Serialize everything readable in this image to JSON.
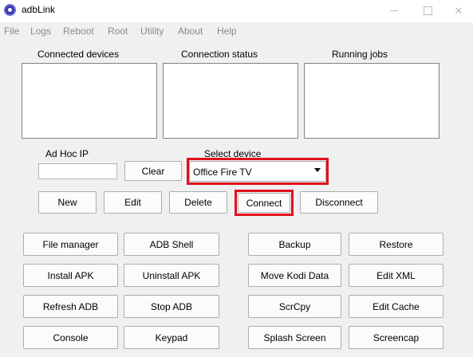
{
  "window": {
    "title": "adbLink"
  },
  "menu": [
    "File",
    "Logs",
    "Reboot",
    "Root",
    "Utility",
    "About",
    "Help"
  ],
  "panels": {
    "connected_devices": "Connected devices",
    "connection_status": "Connection status",
    "running_jobs": "Running jobs"
  },
  "adhoc": {
    "label": "Ad Hoc IP",
    "value": "",
    "clear": "Clear"
  },
  "device": {
    "label": "Select device",
    "selected": "Office Fire TV"
  },
  "connection_buttons": {
    "new": "New",
    "edit": "Edit",
    "delete": "Delete",
    "connect": "Connect",
    "disconnect": "Disconnect"
  },
  "tools": {
    "file_manager": "File manager",
    "adb_shell": "ADB Shell",
    "install_apk": "Install APK",
    "uninstall_apk": "Uninstall APK",
    "refresh_adb": "Refresh ADB",
    "stop_adb": "Stop ADB",
    "console": "Console",
    "keypad": "Keypad",
    "backup": "Backup",
    "restore": "Restore",
    "move_kodi_data": "Move Kodi Data",
    "edit_xml": "Edit XML",
    "scrcpy": "ScrCpy",
    "edit_cache": "Edit Cache",
    "splash_screen": "Splash Screen",
    "screencap": "Screencap"
  },
  "highlight_color": "#e0101e"
}
